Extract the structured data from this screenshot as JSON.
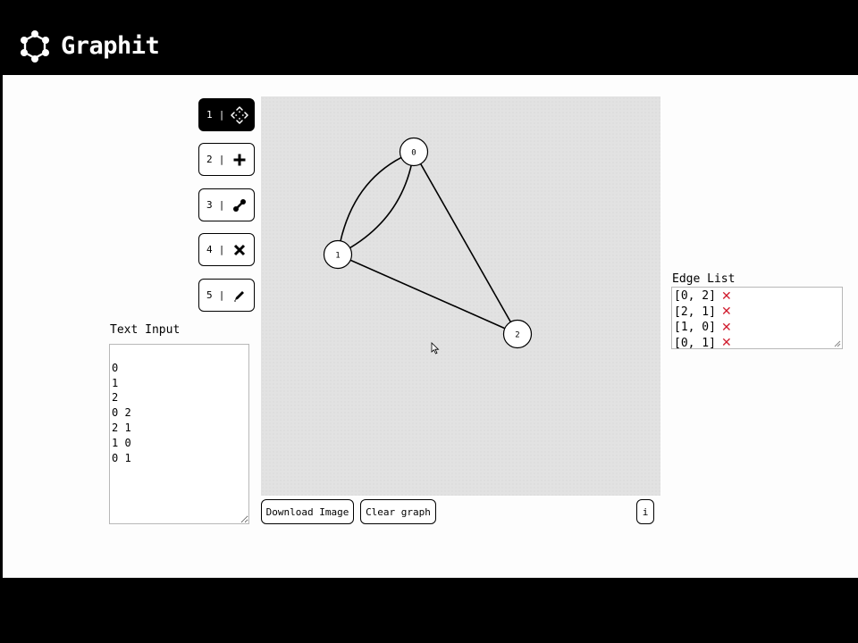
{
  "app": {
    "brand": "Graphit",
    "logo_icon": "graph-logo-icon"
  },
  "toolbar": {
    "tools": [
      {
        "number": "1",
        "sep": "|",
        "icon": "move-icon",
        "active": true
      },
      {
        "number": "2",
        "sep": "|",
        "icon": "plus-icon",
        "active": false
      },
      {
        "number": "3",
        "sep": "|",
        "icon": "connect-edge-icon",
        "active": false
      },
      {
        "number": "4",
        "sep": "|",
        "icon": "delete-x-icon",
        "active": false
      },
      {
        "number": "5",
        "sep": "|",
        "icon": "pencil-icon",
        "active": false
      }
    ]
  },
  "text_input": {
    "label": "Text Input",
    "value": "\n0\n1\n2\n0 2\n2 1\n1 0\n0 1"
  },
  "graph": {
    "nodes": [
      {
        "id": "0",
        "label": "0"
      },
      {
        "id": "1",
        "label": "1"
      },
      {
        "id": "2",
        "label": "2"
      }
    ],
    "edges": [
      {
        "from": "0",
        "to": "2"
      },
      {
        "from": "2",
        "to": "1"
      },
      {
        "from": "1",
        "to": "0"
      },
      {
        "from": "0",
        "to": "1"
      }
    ]
  },
  "buttons": {
    "download": "Download Image",
    "clear": "Clear graph",
    "info": "i"
  },
  "edge_list": {
    "label": "Edge List",
    "items": [
      "[0, 2]",
      "[2, 1]",
      "[1, 0]",
      "[0, 1]"
    ],
    "delete_icon": "red-x-icon"
  },
  "colors": {
    "accent": "#000000",
    "delete": "#d01c2e",
    "canvas_bg": "#e2e2e2"
  }
}
